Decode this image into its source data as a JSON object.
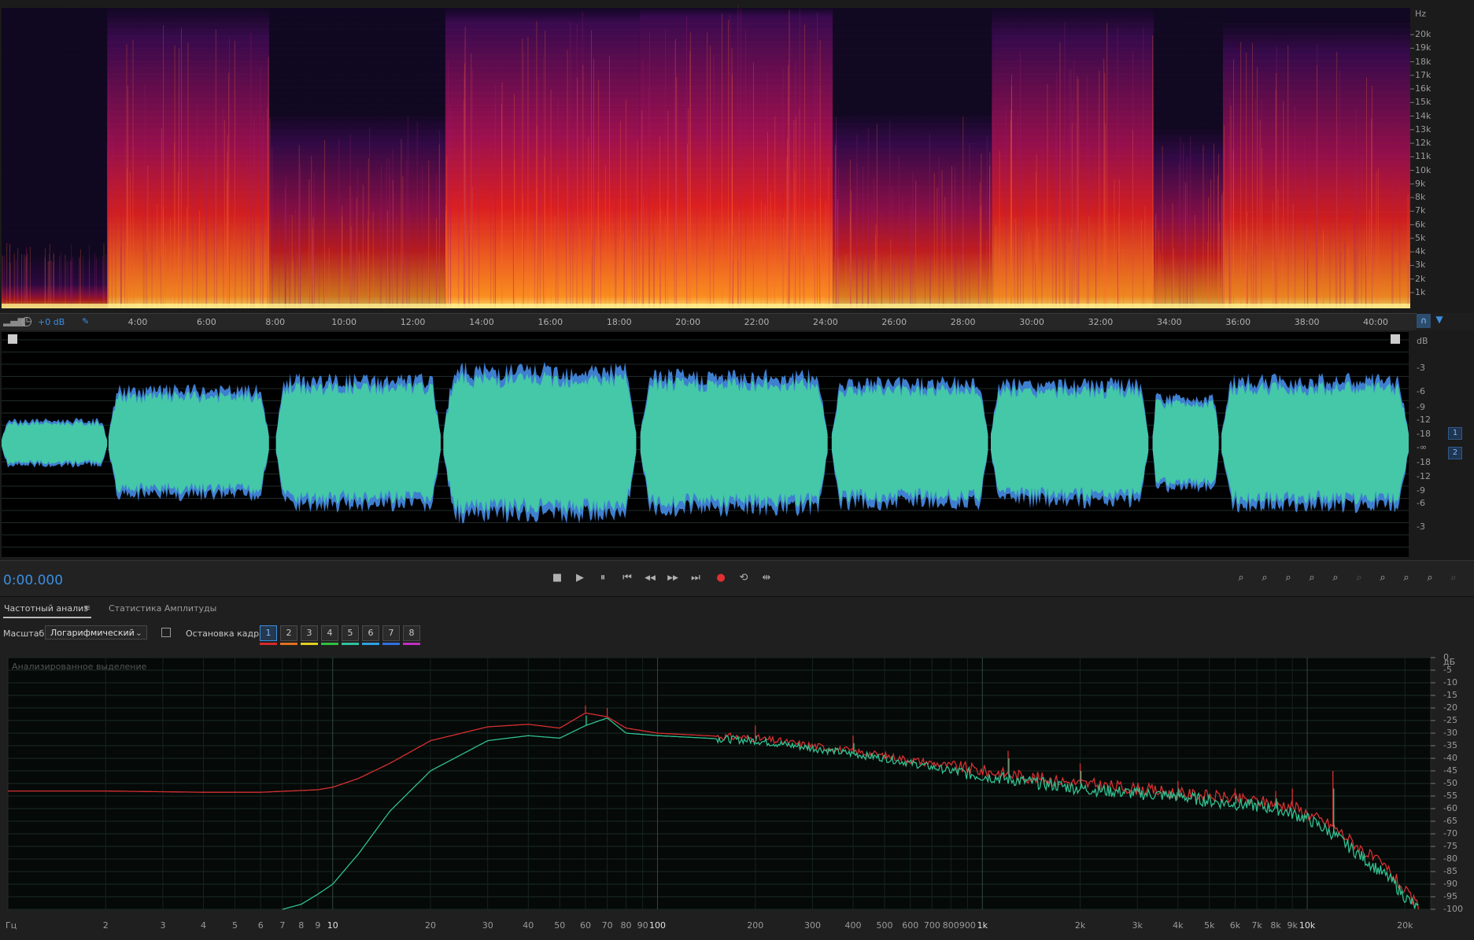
{
  "spectrogram": {
    "unit": "Hz",
    "freq_labels": [
      "20k",
      "19k",
      "18k",
      "17k",
      "16k",
      "15k",
      "14k",
      "13k",
      "12k",
      "11k",
      "10k",
      "9k",
      "8k",
      "7k",
      "6k",
      "5k",
      "4k",
      "3k",
      "2k",
      "1k"
    ],
    "segments": [
      {
        "t0": 0,
        "t1": 0.075,
        "hi": 0.08,
        "dens": 0.35
      },
      {
        "t0": 0.075,
        "t1": 0.19,
        "hi": 0.9,
        "dens": 0.85
      },
      {
        "t0": 0.19,
        "t1": 0.315,
        "hi": 0.55,
        "dens": 0.55
      },
      {
        "t0": 0.315,
        "t1": 0.453,
        "hi": 0.95,
        "dens": 0.95
      },
      {
        "t0": 0.453,
        "t1": 0.59,
        "hi": 0.97,
        "dens": 0.95
      },
      {
        "t0": 0.59,
        "t1": 0.703,
        "hi": 0.55,
        "dens": 0.65
      },
      {
        "t0": 0.703,
        "t1": 0.818,
        "hi": 0.9,
        "dens": 0.85
      },
      {
        "t0": 0.818,
        "t1": 0.867,
        "hi": 0.5,
        "dens": 0.6
      },
      {
        "t0": 0.867,
        "t1": 1.0,
        "hi": 0.85,
        "dens": 0.8
      }
    ]
  },
  "ruler": {
    "gain": "+0 dB",
    "time_labels": [
      "4:00",
      "6:00",
      "8:00",
      "10:00",
      "12:00",
      "14:00",
      "16:00",
      "18:00",
      "20:00",
      "22:00",
      "24:00",
      "26:00",
      "28:00",
      "30:00",
      "32:00",
      "34:00",
      "36:00",
      "38:00",
      "40:00"
    ]
  },
  "waveform": {
    "db_labels_top": [
      "dB",
      "-3",
      "-6",
      "-9",
      "-12",
      "-18",
      "-∞"
    ],
    "db_labels_bottom": [
      "-18",
      "-12",
      "-9",
      "-6",
      "-3"
    ],
    "channels": [
      "1",
      "2"
    ],
    "segments": [
      {
        "t0": 0,
        "t1": 0.075,
        "amp": 0.22
      },
      {
        "t0": 0.076,
        "t1": 0.19,
        "amp": 0.52
      },
      {
        "t0": 0.195,
        "t1": 0.312,
        "amp": 0.62
      },
      {
        "t0": 0.314,
        "t1": 0.451,
        "amp": 0.72
      },
      {
        "t0": 0.454,
        "t1": 0.587,
        "amp": 0.66
      },
      {
        "t0": 0.59,
        "t1": 0.701,
        "amp": 0.6
      },
      {
        "t0": 0.703,
        "t1": 0.815,
        "amp": 0.58
      },
      {
        "t0": 0.818,
        "t1": 0.865,
        "amp": 0.45
      },
      {
        "t0": 0.867,
        "t1": 1.0,
        "amp": 0.62
      }
    ]
  },
  "transport": {
    "timecode": "0:00.000",
    "buttons": [
      {
        "name": "stop-button",
        "glyph": "■"
      },
      {
        "name": "play-button",
        "glyph": "▶"
      },
      {
        "name": "pause-button",
        "glyph": "⏸"
      },
      {
        "name": "skip-start-button",
        "glyph": "⏮"
      },
      {
        "name": "rewind-button",
        "glyph": "◀◀"
      },
      {
        "name": "fast-forward-button",
        "glyph": "▶▶"
      },
      {
        "name": "skip-end-button",
        "glyph": "⏭"
      },
      {
        "name": "record-button",
        "glyph": "●"
      },
      {
        "name": "loop-button",
        "glyph": "⟲"
      },
      {
        "name": "skip-selection-button",
        "glyph": "⇹"
      }
    ],
    "zoom_buttons": [
      "zoom-in-amplitude-icon",
      "zoom-out-amplitude-icon",
      "zoom-in-time-icon",
      "zoom-out-time-icon",
      "zoom-in-point-icon",
      "zoom-out-full-icon",
      "zoom-in-left-icon",
      "zoom-in-right-icon",
      "zoom-selection-icon",
      "zoom-reset-icon",
      "zoom-in-playhead-icon"
    ]
  },
  "analysis_panel": {
    "tab_active": "Частотный анализ",
    "tab_menu": "≡",
    "tab_other": "Статистика Амплитуды",
    "scale_label": "Масштаб:",
    "scale_value": "Логарифмический",
    "freeze_label": "Остановка кадра:",
    "frames": [
      "1",
      "2",
      "3",
      "4",
      "5",
      "6",
      "7",
      "8"
    ],
    "frame_colors": [
      "#d42a2a",
      "#e07020",
      "#e0d020",
      "#30c040",
      "#30c0a0",
      "#30a0e0",
      "#3070e0",
      "#c030c0"
    ],
    "graph_title": "Анализированное выделение",
    "db_unit": "дБ",
    "db_ticks": [
      "0",
      "-5",
      "-10",
      "-15",
      "-20",
      "-25",
      "-30",
      "-35",
      "-40",
      "-45",
      "-50",
      "-55",
      "-60",
      "-65",
      "-70",
      "-75",
      "-80",
      "-85",
      "-90",
      "-95",
      "-100"
    ],
    "freq_unit": "Гц",
    "freq_ticks": [
      {
        "f": 2,
        "label": "2"
      },
      {
        "f": 3,
        "label": "3"
      },
      {
        "f": 4,
        "label": "4"
      },
      {
        "f": 5,
        "label": "5"
      },
      {
        "f": 6,
        "label": "6"
      },
      {
        "f": 7,
        "label": "7"
      },
      {
        "f": 8,
        "label": "8"
      },
      {
        "f": 9,
        "label": "9"
      },
      {
        "f": 10,
        "label": "10",
        "major": true
      },
      {
        "f": 20,
        "label": "20"
      },
      {
        "f": 30,
        "label": "30"
      },
      {
        "f": 40,
        "label": "40"
      },
      {
        "f": 50,
        "label": "50"
      },
      {
        "f": 60,
        "label": "60"
      },
      {
        "f": 70,
        "label": "70"
      },
      {
        "f": 80,
        "label": "80"
      },
      {
        "f": 90,
        "label": "90"
      },
      {
        "f": 100,
        "label": "100",
        "major": true
      },
      {
        "f": 200,
        "label": "200"
      },
      {
        "f": 300,
        "label": "300"
      },
      {
        "f": 400,
        "label": "400"
      },
      {
        "f": 500,
        "label": "500"
      },
      {
        "f": 600,
        "label": "600"
      },
      {
        "f": 700,
        "label": "700"
      },
      {
        "f": 800,
        "label": "800"
      },
      {
        "f": 900,
        "label": "900"
      },
      {
        "f": 1000,
        "label": "1k",
        "major": true
      },
      {
        "f": 2000,
        "label": "2k"
      },
      {
        "f": 3000,
        "label": "3k"
      },
      {
        "f": 4000,
        "label": "4k"
      },
      {
        "f": 5000,
        "label": "5k"
      },
      {
        "f": 6000,
        "label": "6k"
      },
      {
        "f": 7000,
        "label": "7k"
      },
      {
        "f": 8000,
        "label": "8k"
      },
      {
        "f": 9000,
        "label": "9k"
      },
      {
        "f": 10000,
        "label": "10k",
        "major": true
      },
      {
        "f": 20000,
        "label": "20k"
      }
    ]
  },
  "chart_data": {
    "type": "line",
    "title": "Анализированное выделение",
    "xlabel": "Гц",
    "ylabel": "дБ",
    "x_scale": "log",
    "xlim": [
      1,
      24000
    ],
    "ylim": [
      -100,
      0
    ],
    "series": [
      {
        "color": "#d63030",
        "points": [
          [
            1,
            -53
          ],
          [
            2,
            -53
          ],
          [
            4,
            -53.5
          ],
          [
            6,
            -53.5
          ],
          [
            9,
            -52.5
          ],
          [
            10,
            -51.5
          ],
          [
            12,
            -48
          ],
          [
            15,
            -42
          ],
          [
            20,
            -33
          ],
          [
            30,
            -27.5
          ],
          [
            40,
            -26.5
          ],
          [
            50,
            -28
          ],
          [
            60,
            -22
          ],
          [
            70,
            -23.5
          ],
          [
            80,
            -28
          ],
          [
            100,
            -30
          ],
          [
            200,
            -32
          ],
          [
            300,
            -35
          ],
          [
            500,
            -39
          ],
          [
            800,
            -43
          ],
          [
            1000,
            -45
          ],
          [
            2000,
            -50
          ],
          [
            3000,
            -52
          ],
          [
            4000,
            -54
          ],
          [
            5000,
            -55
          ],
          [
            7000,
            -57
          ],
          [
            8000,
            -58
          ],
          [
            9000,
            -59
          ],
          [
            10000,
            -62
          ],
          [
            12000,
            -67
          ],
          [
            15000,
            -77
          ],
          [
            18000,
            -85
          ],
          [
            20000,
            -93
          ],
          [
            22000,
            -99
          ]
        ]
      },
      {
        "color": "#30c090",
        "points": [
          [
            7,
            -100
          ],
          [
            8,
            -98
          ],
          [
            9,
            -94
          ],
          [
            10,
            -90
          ],
          [
            12,
            -78
          ],
          [
            15,
            -61
          ],
          [
            20,
            -45
          ],
          [
            30,
            -33
          ],
          [
            40,
            -31
          ],
          [
            50,
            -32
          ],
          [
            60,
            -27
          ],
          [
            70,
            -24
          ],
          [
            80,
            -30
          ],
          [
            100,
            -31
          ],
          [
            200,
            -33
          ],
          [
            300,
            -36
          ],
          [
            500,
            -40
          ],
          [
            800,
            -45
          ],
          [
            1000,
            -47
          ],
          [
            2000,
            -52
          ],
          [
            3000,
            -54
          ],
          [
            4000,
            -55
          ],
          [
            5000,
            -57
          ],
          [
            7000,
            -59
          ],
          [
            8000,
            -60
          ],
          [
            9000,
            -62
          ],
          [
            10000,
            -64
          ],
          [
            12000,
            -70
          ],
          [
            15000,
            -80
          ],
          [
            18000,
            -88
          ],
          [
            20000,
            -95
          ],
          [
            22000,
            -100
          ]
        ]
      }
    ],
    "peaks_red": [
      [
        60,
        -19
      ],
      [
        70,
        -20
      ],
      [
        200,
        -27
      ],
      [
        400,
        -31
      ],
      [
        1200,
        -37
      ],
      [
        2000,
        -42
      ],
      [
        4000,
        -49
      ],
      [
        6000,
        -52
      ],
      [
        8000,
        -53
      ],
      [
        9000,
        -52
      ],
      [
        12000,
        -45
      ]
    ],
    "peaks_green": [
      [
        60,
        -23
      ],
      [
        70,
        -24
      ],
      [
        200,
        -31
      ],
      [
        400,
        -34
      ],
      [
        1200,
        -40
      ],
      [
        2000,
        -45
      ],
      [
        4000,
        -52
      ],
      [
        6000,
        -55
      ],
      [
        8000,
        -56
      ],
      [
        12000,
        -52
      ]
    ]
  }
}
